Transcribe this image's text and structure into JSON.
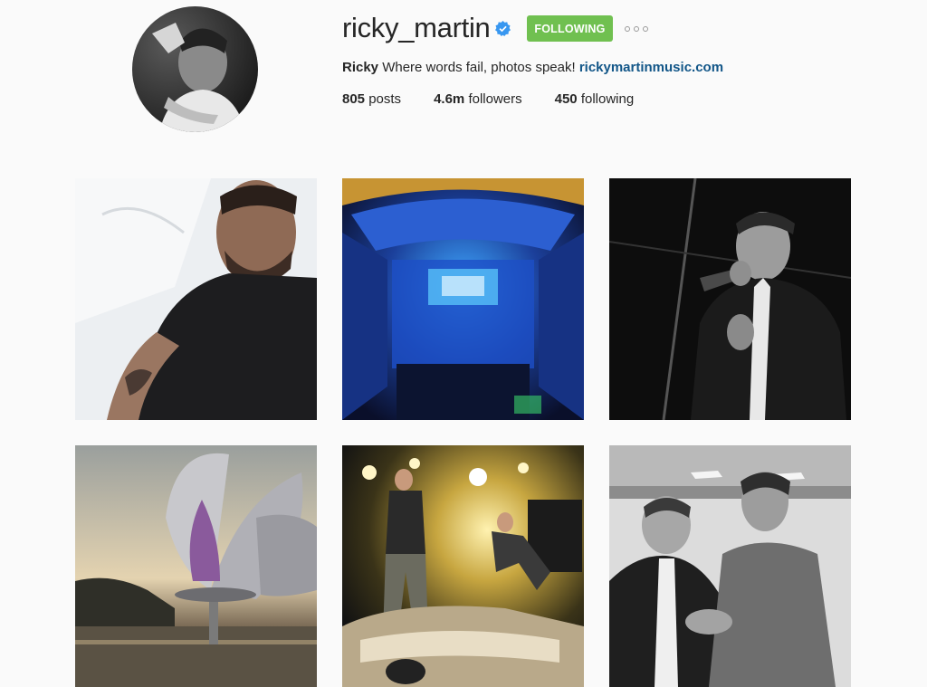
{
  "profile": {
    "username": "ricky_martin",
    "verified_icon": "verified-badge-icon",
    "follow_button_label": "FOLLOWING",
    "more_icon": "more-options-icon",
    "bio_name": "Ricky",
    "bio_text": "Where words fail, photos speak!",
    "bio_link": "rickymartinmusic.com",
    "posts_count": "805",
    "posts_label": "posts",
    "followers_count": "4.6m",
    "followers_label": "followers",
    "following_count": "450",
    "following_label": "following"
  },
  "colors": {
    "follow_button": "#70c050",
    "verified_badge": "#3897f0",
    "link": "#125688"
  },
  "posts": [
    {
      "subject": "selfie in black t-shirt"
    },
    {
      "subject": "stadium concert crowd in blue light"
    },
    {
      "subject": "black and white singing with microphone"
    },
    {
      "subject": "metal flower sculpture at sunset"
    },
    {
      "subject": "concert stage performance on car"
    },
    {
      "subject": "black and white handshake photo"
    }
  ]
}
